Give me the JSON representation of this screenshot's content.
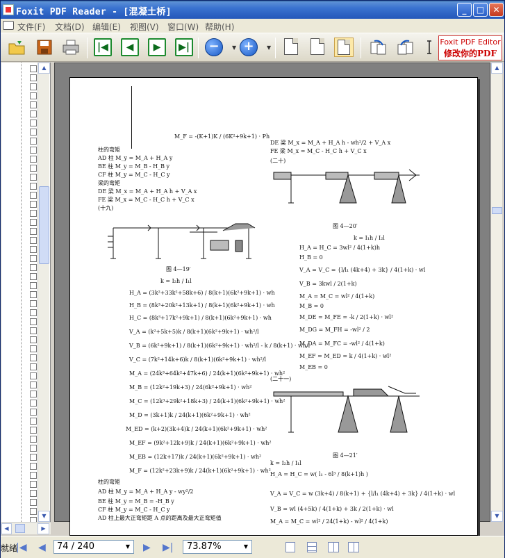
{
  "window": {
    "title": "Foxit PDF Reader - [混凝土桥]",
    "buttons": {
      "minimize": "_",
      "maximize": "□",
      "close": "✕"
    }
  },
  "menu": {
    "items": [
      "文件(F)",
      "文档(D)",
      "编辑(E)",
      "视图(V)",
      "窗口(W)",
      "帮助(H)"
    ]
  },
  "toolbar": {
    "ad_line1": "Foxit PDF Editor",
    "ad_line2": "修改你的PDF"
  },
  "status": {
    "text": "就绪",
    "page_display": "74 / 240",
    "zoom": "73.87%"
  },
  "page": {
    "left": [
      "M_F = -(K+1)K / (6K²+9k+1) · Ph",
      "柱的弯矩",
      "AD 柱     M_y = M_A + H_A y",
      "BE 柱     M_y = M_B - H_B y",
      "CF 柱     M_y = M_C - H_C y",
      "梁的弯矩",
      "DE 梁     M_x = M_A + H_A h + V_A x",
      "FE 梁     M_x = M_C - H_C h + V_C x",
      "(十九)",
      "图   4—19′",
      "k = I₂h / I₁l",
      "H_A = (3k²+33k²+58k+6) / 8(k+1)(6k²+9k+1) · wh",
      "H_B = (8k³+20k²+13k+1) / 8(k+1)(6k²+9k+1) · wh",
      "H_C = (8k³+17k²+9k+1) / 8(k+1)(6k²+9k+1) · wh",
      "V_A = (k²+5k+5)k / 8(k+1)(6k²+9k+1) · wh²/l",
      "V_B = (6k²+9k+1) / 8(k+1)(6k²+9k+1) · wh²/l - k / 8(k+1) · wh/l",
      "V_C = (7k²+14k+6)k / 8(k+1)(6k²+9k+1) · wh²/l",
      "M_A = (24k³+64k²+47k+6) / 24(k+1)(6k²+9k+1) · wh²",
      "M_B = (12k²+19k+3) / 24(6k²+9k+1) · wh²",
      "M_C = (12k³+29k²+18k+3) / 24(k+1)(6k²+9k+1) · wh²",
      "M_D = (3k+1)k / 24(k+1)(6k²+9k+1) · wh²",
      "M_ED = (k+2)(3k+4)k / 24(k+1)(6k²+9k+1) · wh²",
      "M_EF = (9k²+12k+9)k / 24(k+1)(6k²+9k+1) · wh²",
      "M_EB = (12k+17)k / 24(k+1)(6k²+9k+1) · wh²",
      "M_F = (12k²+23k+9)k / 24(k+1)(6k²+9k+1) · wh²",
      "柱的弯矩",
      "AD 柱     M_y = M_A + H_A y - wy²/2",
      "BE 柱     M_y = M_B = -H_B y",
      "CF 柱     M_y = M_C - H_C y",
      "AD 柱上最大正弯矩距 A 点的距离及最大正弯矩值"
    ],
    "right": [
      "DE 梁     M_x = M_A + H_A h - wh²/2 + V_A x",
      "FE 梁     M_x = M_C - H_C h + V_C x",
      "(二十)",
      "图   4—20′",
      "k = I₁h / I₂l",
      "H_A = H_C = 3wl² / 4(1+k)h",
      "H_B = 0",
      "V_A = V_C = {l/l₁ (4k+4) + 3k} / 4(1+k) · wl",
      "V_B = 3kwl / 2(1+k)",
      "M_A = M_C = wl² / 4(1+k)",
      "M_B = 0",
      "M_DE = M_FE = -k / 2(1+k) · wl²",
      "M_DG = M_FH = -wl² / 2",
      "M_DA = M_FC = -wl² / 4(1+k)",
      "M_EF = M_ED = k / 4(1+k) · wl²",
      "M_EB = 0",
      "(二十一)",
      "图   4—21′",
      "k = I₂h / I₁l",
      "H_A = H_C = w( l₁ - 6l³ / 8(k+1)h )",
      "V_A = V_C = w (3k+4) / 8(k+1) + {l/l₁ (4k+4) + 3k} / 4(1+k) · wl",
      "V_B = wl (4+5k) / 4(1+k) + 3k / 2(1+k) · wl",
      "M_A = M_C = wl² / 24(1+k) - wl² / 4(1+k)"
    ]
  }
}
